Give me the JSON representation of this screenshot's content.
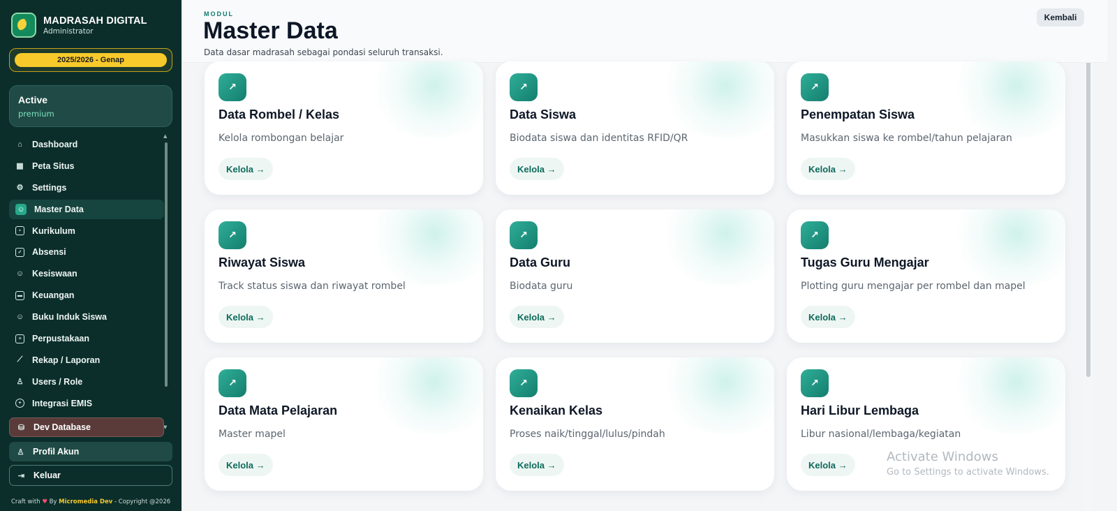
{
  "brand": {
    "title": "MADRASAH DIGITAL",
    "subtitle": "Administrator"
  },
  "academic_year": "2025/2026 - Genap",
  "status": {
    "title": "Active",
    "plan": "premium"
  },
  "nav": [
    {
      "label": "Dashboard",
      "icon": "home-icon"
    },
    {
      "label": "Peta Situs",
      "icon": "grid-icon"
    },
    {
      "label": "Settings",
      "icon": "gear-icon"
    },
    {
      "label": "Master Data",
      "icon": "users-icon",
      "active": true
    },
    {
      "label": "Kurikulum",
      "icon": "calendar-icon"
    },
    {
      "label": "Absensi",
      "icon": "check-square-icon"
    },
    {
      "label": "Kesiswaan",
      "icon": "users-icon"
    },
    {
      "label": "Keuangan",
      "icon": "wallet-icon"
    },
    {
      "label": "Buku Induk Siswa",
      "icon": "users-icon"
    },
    {
      "label": "Perpustakaan",
      "icon": "book-icon"
    },
    {
      "label": "Rekap / Laporan",
      "icon": "chart-icon"
    },
    {
      "label": "Users / Role",
      "icon": "user-icon"
    },
    {
      "label": "Integrasi EMIS",
      "icon": "plus-circle-icon"
    }
  ],
  "dev_database": "Dev Database",
  "profile": "Profil Akun",
  "logout": "Keluar",
  "footer": {
    "prefix": "Craft with",
    "heart": "♥",
    "by": "By",
    "brand": "Micromedia Dev",
    "suffix": "- Copyright @2026"
  },
  "header": {
    "eyebrow": "MODUL",
    "title": "Master Data",
    "subtitle": "Data dasar madrasah sebagai pondasi seluruh transaksi.",
    "back_label": "Kembali"
  },
  "cards": [
    {
      "title": "Data Rombel / Kelas",
      "desc": "Kelola rombongan belajar",
      "action": "Kelola →"
    },
    {
      "title": "Data Siswa",
      "desc": "Biodata siswa dan identitas RFID/QR",
      "action": "Kelola →"
    },
    {
      "title": "Penempatan Siswa",
      "desc": "Masukkan siswa ke rombel/tahun pelajaran",
      "action": "Kelola →"
    },
    {
      "title": "Riwayat Siswa",
      "desc": "Track status siswa dan riwayat rombel",
      "action": "Kelola →"
    },
    {
      "title": "Data Guru",
      "desc": "Biodata guru",
      "action": "Kelola →"
    },
    {
      "title": "Tugas Guru Mengajar",
      "desc": "Plotting guru mengajar per rombel dan mapel",
      "action": "Kelola →"
    },
    {
      "title": "Data Mata Pelajaran",
      "desc": "Master mapel",
      "action": "Kelola →"
    },
    {
      "title": "Kenaikan Kelas",
      "desc": "Proses naik/tinggal/lulus/pindah",
      "action": "Kelola →"
    },
    {
      "title": "Hari Libur Lembaga",
      "desc": "Libur nasional/lembaga/kegiatan",
      "action": "Kelola →"
    }
  ],
  "card_icon_glyph": "↗",
  "watermark": {
    "title": "Activate Windows",
    "subtitle": "Go to Settings to activate Windows."
  }
}
